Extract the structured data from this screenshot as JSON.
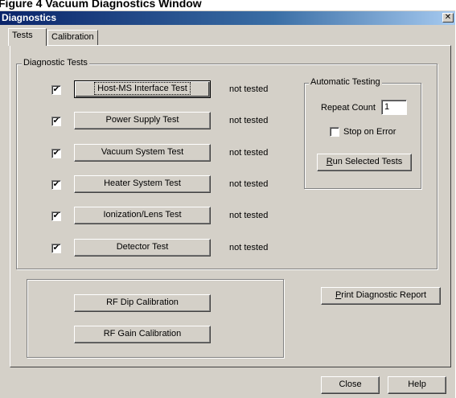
{
  "caption": {
    "prefix": "Figure 4  Vacuum Diagnostics Window"
  },
  "window": {
    "title": "Diagnostics",
    "close_glyph": "✕"
  },
  "tabs": [
    {
      "label": "Tests"
    },
    {
      "label": "Calibration"
    }
  ],
  "diagnostic_tests": {
    "group_label": "Diagnostic Tests",
    "tests": [
      {
        "label": "Host-MS Interface Test",
        "checked": true,
        "status": "not tested"
      },
      {
        "label": "Power Supply Test",
        "checked": true,
        "status": "not tested"
      },
      {
        "label": "Vacuum System Test",
        "checked": true,
        "status": "not tested"
      },
      {
        "label": "Heater System Test",
        "checked": true,
        "status": "not tested"
      },
      {
        "label": "Ionization/Lens Test",
        "checked": true,
        "status": "not tested"
      },
      {
        "label": "Detector Test",
        "checked": true,
        "status": "not tested"
      }
    ],
    "check_glyph": "✔"
  },
  "automatic_testing": {
    "group_label": "Automatic Testing",
    "repeat_count_label": "Repeat Count",
    "repeat_count_value": "1",
    "stop_on_error_label": "Stop on Error",
    "stop_on_error_checked": false,
    "run_button": {
      "mnemonic": "R",
      "rest": "un Selected Tests"
    }
  },
  "calibration_buttons": [
    {
      "label": "RF Dip Calibration"
    },
    {
      "label": "RF Gain Calibration"
    }
  ],
  "print_button": {
    "mnemonic": "P",
    "rest": "rint Diagnostic Report"
  },
  "footer": {
    "close_label": "Close",
    "help_label": "Help"
  }
}
